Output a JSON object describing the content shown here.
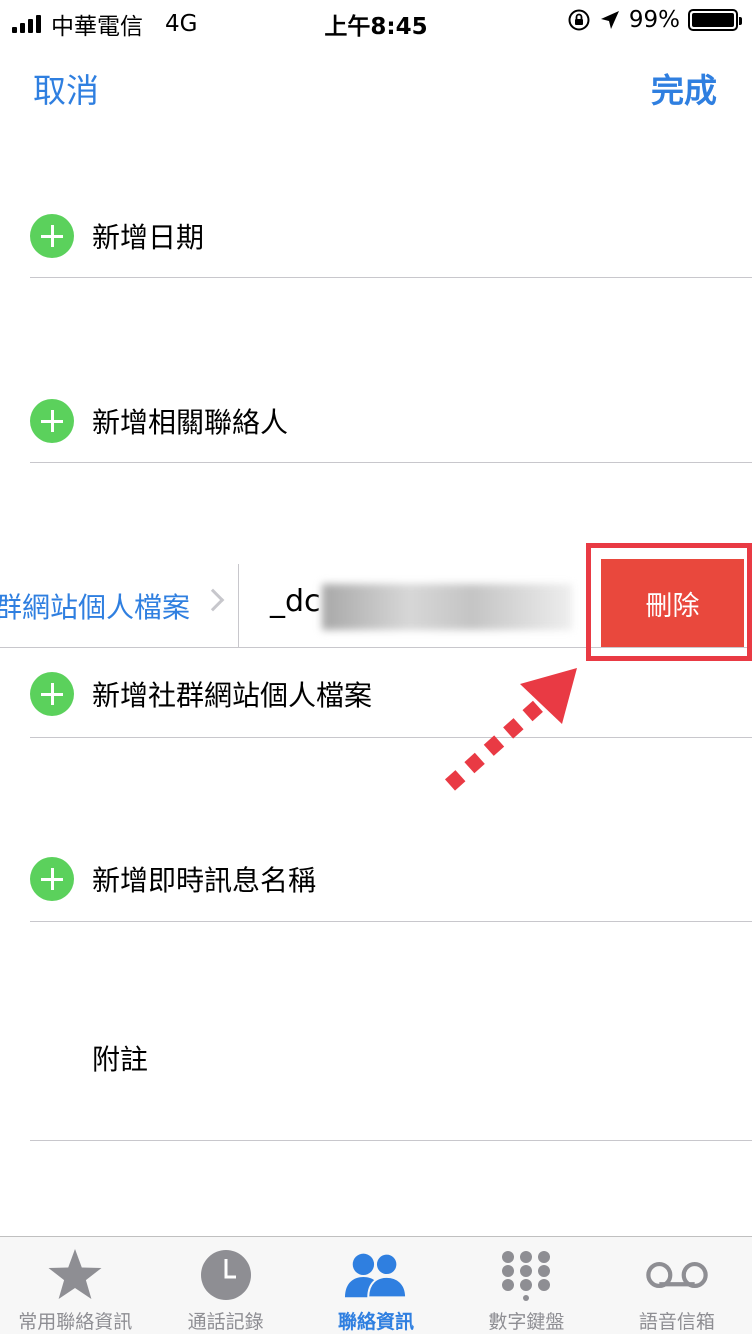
{
  "status_bar": {
    "carrier": "中華電信",
    "network": "4G",
    "time": "上午8:45",
    "battery_percent": "99%",
    "battery_level": 0.99
  },
  "nav": {
    "cancel_label": "取消",
    "done_label": "完成"
  },
  "rows": {
    "add_date": "新增日期",
    "add_related": "新增相關聯絡人",
    "add_social": "新增社群網站個人檔案",
    "add_im": "新增即時訊息名稱",
    "note": "附註"
  },
  "social_entry": {
    "type_label": "群網站個人檔案",
    "value": "_dc",
    "delete_label": "刪除"
  },
  "tab_bar": {
    "items": [
      {
        "label": "常用聯絡資訊",
        "icon": "star-icon"
      },
      {
        "label": "通話記錄",
        "icon": "clock-icon"
      },
      {
        "label": "聯絡資訊",
        "icon": "contacts-icon"
      },
      {
        "label": "數字鍵盤",
        "icon": "keypad-icon"
      },
      {
        "label": "語音信箱",
        "icon": "voicemail-icon"
      }
    ],
    "active_index": 2
  },
  "colors": {
    "accent": "#2f7fe0",
    "add_green": "#5bd15c",
    "delete_red": "#e9483d",
    "annotation_red": "#e93a44"
  }
}
